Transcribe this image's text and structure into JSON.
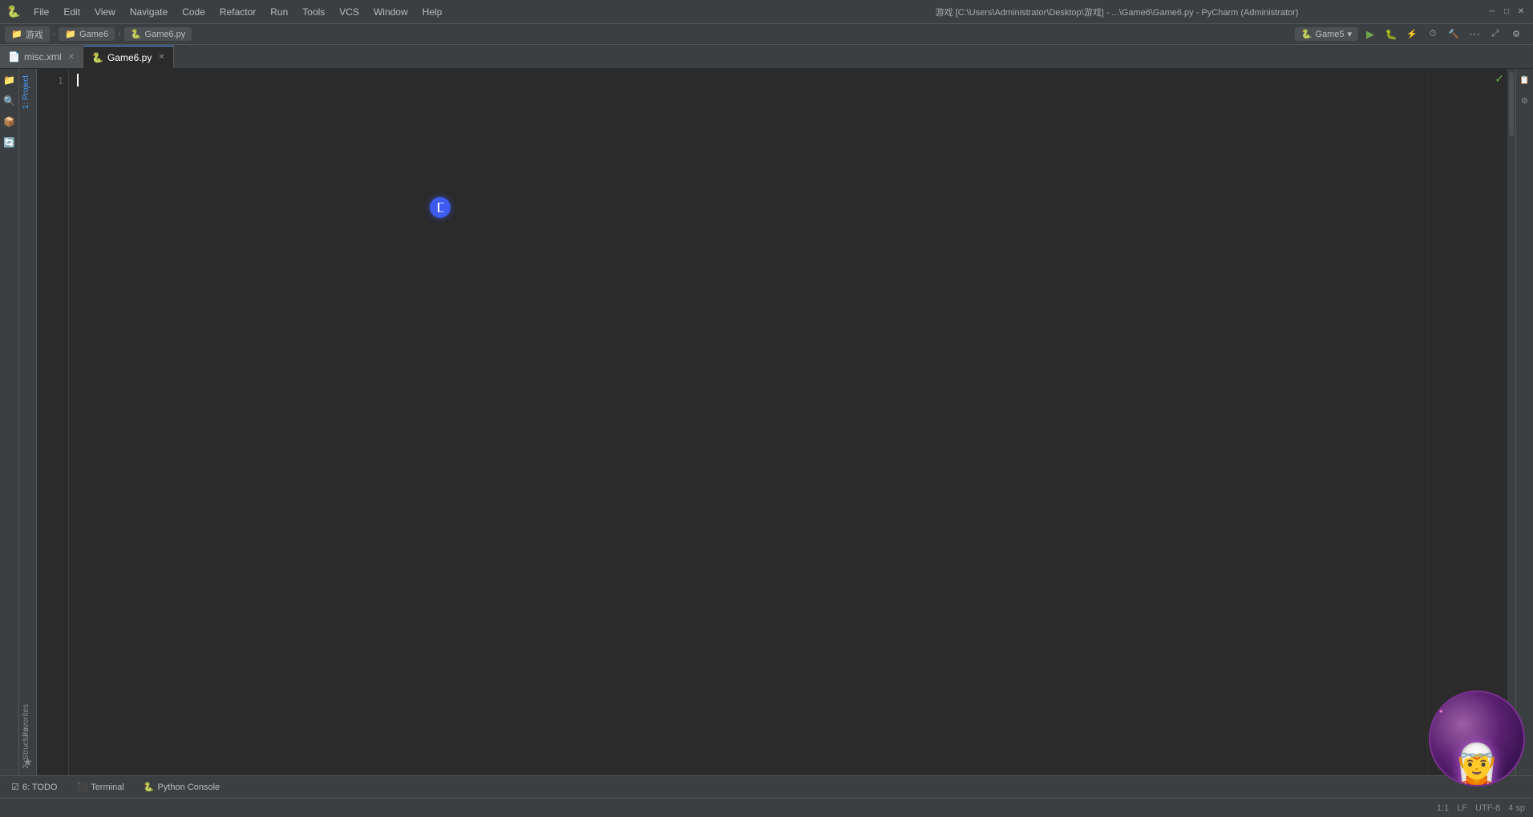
{
  "window": {
    "title": "游戏 [C:\\Users\\Administrator\\Desktop\\游戏] - ...\\Game6\\Game6.py - PyCharm (Administrator)",
    "app_icon": "🐍"
  },
  "menu": {
    "items": [
      "File",
      "Edit",
      "View",
      "Navigate",
      "Code",
      "Refactor",
      "Run",
      "Tools",
      "VCS",
      "Window",
      "Help"
    ]
  },
  "nav_breadcrumb": {
    "parts": [
      "游戏",
      "Game6",
      "Game6.py"
    ]
  },
  "editor_tabs": [
    {
      "name": "misc.xml",
      "icon": "📄",
      "active": false,
      "close": true
    },
    {
      "name": "Game6.py",
      "icon": "🐍",
      "active": true,
      "close": true
    }
  ],
  "run_config": {
    "label": "Game5",
    "icon": "▶"
  },
  "toolbar_actions": [
    {
      "id": "play",
      "icon": "▶",
      "label": "Run"
    },
    {
      "id": "debug",
      "icon": "🐛",
      "label": "Debug"
    },
    {
      "id": "run-coverage",
      "icon": "⚡",
      "label": "Coverage"
    },
    {
      "id": "profile",
      "icon": "📊",
      "label": "Profile"
    },
    {
      "id": "build",
      "icon": "🔨",
      "label": "Build"
    },
    {
      "id": "more",
      "icon": "⋯",
      "label": "More"
    }
  ],
  "left_sidebar": {
    "icons": [
      "📁",
      "🔍",
      "📦",
      "🔄"
    ]
  },
  "left_panels": {
    "labels": [
      "1: Project",
      "2: Structure",
      "Favorites"
    ]
  },
  "bottom_toolbar": {
    "items": [
      {
        "id": "todo",
        "icon": "☑",
        "label": "6: TODO"
      },
      {
        "id": "terminal",
        "icon": "⬛",
        "label": "Terminal"
      },
      {
        "id": "python-console",
        "icon": "🐍",
        "label": "Python Console"
      }
    ]
  },
  "status_bar": {
    "left": [],
    "right": [
      {
        "id": "position",
        "label": "1:1"
      },
      {
        "id": "encoding",
        "label": "LF"
      },
      {
        "id": "charset",
        "label": "UTF-8"
      },
      {
        "id": "indent",
        "label": "4 sp"
      }
    ]
  },
  "editor": {
    "content": ""
  },
  "colors": {
    "active_tab_indicator": "#4a9eff",
    "play_green": "#6ea750",
    "debug_blue": "#4a9eff",
    "blue_dot": "#3d5af1",
    "bg_dark": "#2b2b2b",
    "bg_medium": "#3c3f41"
  }
}
